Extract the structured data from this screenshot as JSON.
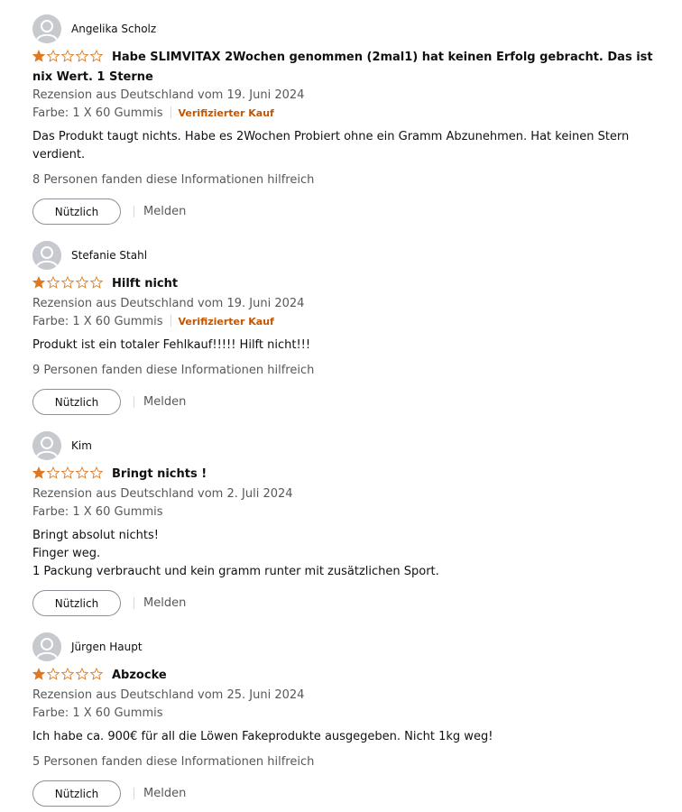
{
  "reviews": [
    {
      "author": "Angelika Scholz",
      "rating": 1,
      "title": "Habe SLIMVITAX 2Wochen genommen (2mal1) hat keinen Erfolg gebracht. Das ist nix Wert. 1 Sterne",
      "date_line": "Rezension aus Deutschland vom 19. Juni 2024",
      "variant": "Farbe: 1 X 60 Gummis",
      "verified": "Verifizierter Kauf",
      "body": [
        "Das Produkt taugt nichts. Habe es 2Wochen Probiert ohne ein Gramm Abzunehmen. Hat keinen Stern verdient."
      ],
      "helpful_text": "8 Personen fanden diese Informationen hilfreich",
      "helpful_button": "Nützlich",
      "report": "Melden"
    },
    {
      "author": "Stefanie Stahl",
      "rating": 1,
      "title": "Hilft nicht",
      "date_line": "Rezension aus Deutschland vom 19. Juni 2024",
      "variant": "Farbe: 1 X 60 Gummis",
      "verified": "Verifizierter Kauf",
      "body": [
        "Produkt ist ein totaler Fehlkauf!!!!! Hilft nicht!!!"
      ],
      "helpful_text": "9 Personen fanden diese Informationen hilfreich",
      "helpful_button": "Nützlich",
      "report": "Melden"
    },
    {
      "author": "Kim",
      "rating": 1,
      "title": "Bringt nichts !",
      "date_line": "Rezension aus Deutschland vom 2. Juli 2024",
      "variant": "Farbe: 1 X 60 Gummis",
      "verified": "",
      "body": [
        "Bringt absolut nichts!",
        "Finger weg.",
        "1 Packung verbraucht und kein gramm runter mit zusätzlichen Sport."
      ],
      "helpful_text": "",
      "helpful_button": "Nützlich",
      "report": "Melden"
    },
    {
      "author": "Jürgen Haupt",
      "rating": 1,
      "title": "Abzocke",
      "date_line": "Rezension aus Deutschland vom 25. Juni 2024",
      "variant": "Farbe: 1 X 60 Gummis",
      "verified": "",
      "body": [
        "Ich habe ca. 900€ für all die Löwen Fakeprodukte ausgegeben. Nicht 1kg weg!"
      ],
      "helpful_text": "5 Personen fanden diese Informationen hilfreich",
      "helpful_button": "Nützlich",
      "report": "Melden"
    }
  ],
  "colors": {
    "star_filled": "#de7921",
    "star_outline": "#de7921",
    "verified": "#c45500",
    "secondary_text": "#565959"
  }
}
